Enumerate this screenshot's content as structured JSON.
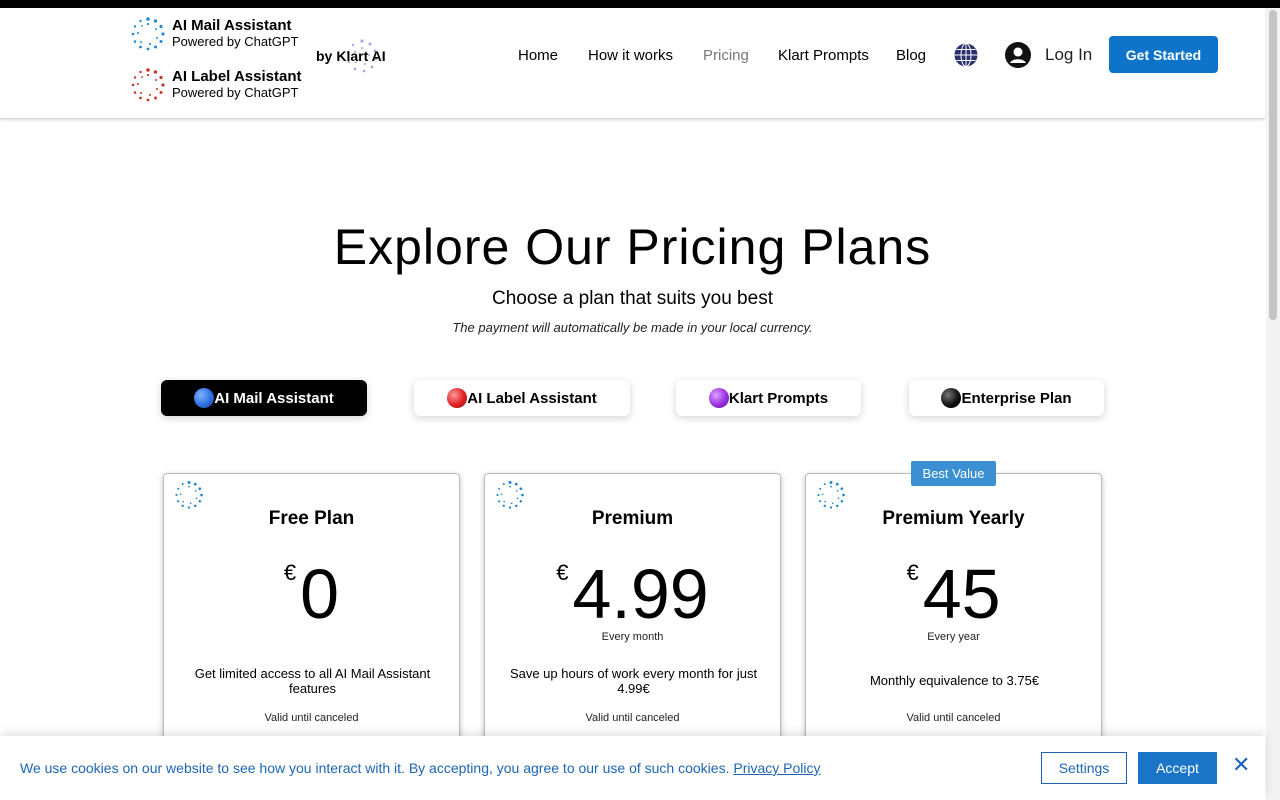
{
  "header": {
    "brands": [
      {
        "name": "AI Mail Assistant",
        "sub": "Powered by ChatGPT",
        "color": "#1f8ad1"
      },
      {
        "name": "AI Label Assistant",
        "sub": "Powered by ChatGPT",
        "color": "#c0392b"
      }
    ],
    "by_label": "by",
    "klart_label": "Klart AI",
    "nav": [
      {
        "label": "Home",
        "active": false
      },
      {
        "label": "How it works",
        "active": false
      },
      {
        "label": "Pricing",
        "active": true
      },
      {
        "label": "Klart Prompts",
        "active": false
      },
      {
        "label": "Blog",
        "active": false
      }
    ],
    "login_label": "Log In",
    "cta_label": "Get Started",
    "cta_color": "#0d74c9"
  },
  "hero": {
    "title": "Explore Our Pricing Plans",
    "subtitle": "Choose a plan that suits you best",
    "note": "The payment will automatically be made in your local currency."
  },
  "tabs": [
    {
      "label": "AI Mail Assistant",
      "dot": "#2f6fe0",
      "active": true
    },
    {
      "label": "AI Label Assistant",
      "dot": "#e02020",
      "active": false
    },
    {
      "label": "Klart Prompts",
      "dot": "#9b30e0",
      "active": false
    },
    {
      "label": "Enterprise Plan",
      "dot": "#111111",
      "active": false
    }
  ],
  "plans": [
    {
      "title": "Free Plan",
      "currency": "€",
      "amount": "0",
      "period": "",
      "desc": "Get limited access to all AI Mail Assistant features",
      "valid": "Valid until canceled"
    },
    {
      "title": "Premium",
      "currency": "€",
      "amount": "4.99",
      "period": "Every month",
      "desc": "Save up hours of work every month for just 4.99€",
      "valid": "Valid until canceled"
    },
    {
      "title": "Premium Yearly",
      "currency": "€",
      "amount": "45",
      "period": "Every year",
      "desc": "Monthly equivalence to 3.75€",
      "valid": "Valid until canceled"
    }
  ],
  "badge": "Best Value",
  "cookie": {
    "message": "We use cookies on our website to see how you interact with it. By accepting, you agree to our use of such cookies.",
    "policy_link": "Privacy Policy",
    "settings_label": "Settings",
    "accept_label": "Accept",
    "close_glyph": "✕"
  }
}
